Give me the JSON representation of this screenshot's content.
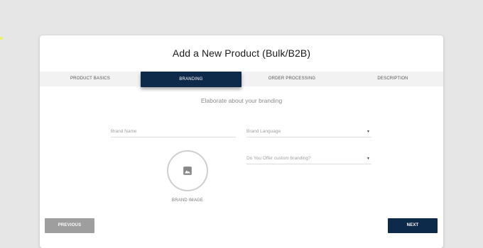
{
  "header": {
    "title": "Add a New Product (Bulk/B2B)"
  },
  "steps": [
    {
      "label": "PRODUCT BASICS",
      "active": false
    },
    {
      "label": "BRANDING",
      "active": true
    },
    {
      "label": "ORDER PROCESSING",
      "active": false
    },
    {
      "label": "DESCRIPTION",
      "active": false
    }
  ],
  "form": {
    "subtitle": "Elaborate about your branding",
    "brand_name": {
      "placeholder": "Brand Name",
      "value": ""
    },
    "brand_language": {
      "placeholder": "Brand Language",
      "value": ""
    },
    "custom_branding": {
      "placeholder": "Do You Offer custom branding?",
      "value": ""
    },
    "brand_image_label": "BRAND IMAGE",
    "brand_image_icon": "image-icon"
  },
  "actions": {
    "previous_label": "PREVIOUS",
    "next_label": "NEXT"
  },
  "colors": {
    "primary": "#0e2a4a",
    "disabled_button": "#9e9e9e",
    "background": "#e6e6e6"
  }
}
